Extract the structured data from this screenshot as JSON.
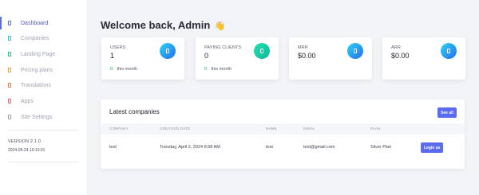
{
  "sidebar": {
    "items": [
      {
        "label": "Dashboard",
        "icon": "dashboard-icon",
        "icon_color": "#5b6bf0",
        "active": true
      },
      {
        "label": "Companies",
        "icon": "companies-icon",
        "icon_color": "#31c0e6"
      },
      {
        "label": "Landing Page",
        "icon": "landing-page-icon",
        "icon_color": "#23b59c"
      },
      {
        "label": "Pricing plans",
        "icon": "pricing-plans-icon",
        "icon_color": "#f59a3b"
      },
      {
        "label": "Translations",
        "icon": "translations-icon",
        "icon_color": "#f0744a"
      },
      {
        "label": "Apps",
        "icon": "apps-icon",
        "icon_color": "#ef5c6c"
      },
      {
        "label": "Site Settings",
        "icon": "site-settings-icon",
        "icon_color": "#9aa0b2"
      }
    ],
    "version": "VERSION 2.1.0",
    "datetime": "2024-05-24 10:10:31"
  },
  "header": {
    "title": "Welcome back, Admin",
    "emoji": "👋"
  },
  "stats": [
    {
      "label": "USERS",
      "value": "1",
      "footer_value": "0",
      "footer_text": "this month",
      "icon": "users-icon",
      "accent": "#246ef0"
    },
    {
      "label": "PAYING CLIENTS",
      "value": "0",
      "footer_value": "0",
      "footer_text": "this month",
      "icon": "paying-clients-icon",
      "accent": "#16b39a"
    },
    {
      "label": "MRR",
      "value": "$0.00",
      "icon": "mrr-icon",
      "accent": "#246ef0"
    },
    {
      "label": "ARR",
      "value": "$0.00",
      "icon": "arr-icon",
      "accent": "#246ef0"
    }
  ],
  "latest_companies": {
    "title": "Latest companies",
    "see_all_label": "See all",
    "columns": [
      "COMPANY",
      "CREATION DATE",
      "NAME",
      "EMAIL",
      "PLAN"
    ],
    "rows": [
      {
        "company": "test",
        "creation_date": "Tuesday, April 2, 2024 8:58 AM",
        "name": "test",
        "email": "test@gmail.com",
        "plan": "Silver Plan",
        "action_label": "Login as"
      }
    ]
  }
}
